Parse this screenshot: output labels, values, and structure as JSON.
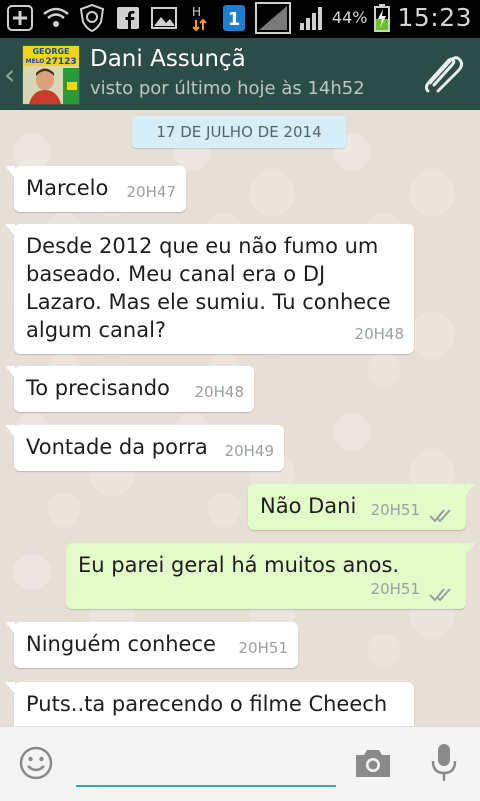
{
  "status_bar": {
    "battery_percent": "44%",
    "time": "15:23",
    "h_label": "H",
    "notification_badge": "1"
  },
  "header": {
    "back_icon": "chevron-left-icon",
    "contact_name": "Dani Assunçã",
    "last_seen": "visto por último hoje às 14h52",
    "attach_icon": "paperclip-icon",
    "avatar_text_1": "GEORGE",
    "avatar_text_2": "MELO",
    "avatar_text_3": "27123"
  },
  "chat": {
    "date_chip": "17 DE JULHO DE 2014",
    "messages": [
      {
        "direction": "in",
        "text": "Marcelo",
        "time": "20H47"
      },
      {
        "direction": "in",
        "text": "Desde 2012 que eu não fumo um baseado. Meu canal era o DJ Lazaro. Mas ele sumiu. Tu conhece algum canal?",
        "time": "20H48"
      },
      {
        "direction": "in",
        "text": "To precisando",
        "time": "20H48"
      },
      {
        "direction": "in",
        "text": "Vontade da porra",
        "time": "20H49"
      },
      {
        "direction": "out",
        "text": "Não Dani",
        "time": "20H51"
      },
      {
        "direction": "out",
        "text": "Eu parei geral há muitos anos.",
        "time": "20H51"
      },
      {
        "direction": "in",
        "text": "Ninguém conhece",
        "time": "20H51"
      },
      {
        "direction": "in",
        "text": "Puts..ta parecendo o filme Cheech",
        "time": ""
      }
    ]
  },
  "input_bar": {
    "message_value": "",
    "emoji_icon": "emoji-icon",
    "camera_icon": "camera-icon",
    "mic_icon": "microphone-icon"
  },
  "colors": {
    "header_bg": "#2c4c48",
    "incoming_bubble": "#ffffff",
    "outgoing_bubble": "#e2fbc9",
    "chat_bg": "#e6dfd6",
    "input_underline": "#2aa4cf"
  }
}
